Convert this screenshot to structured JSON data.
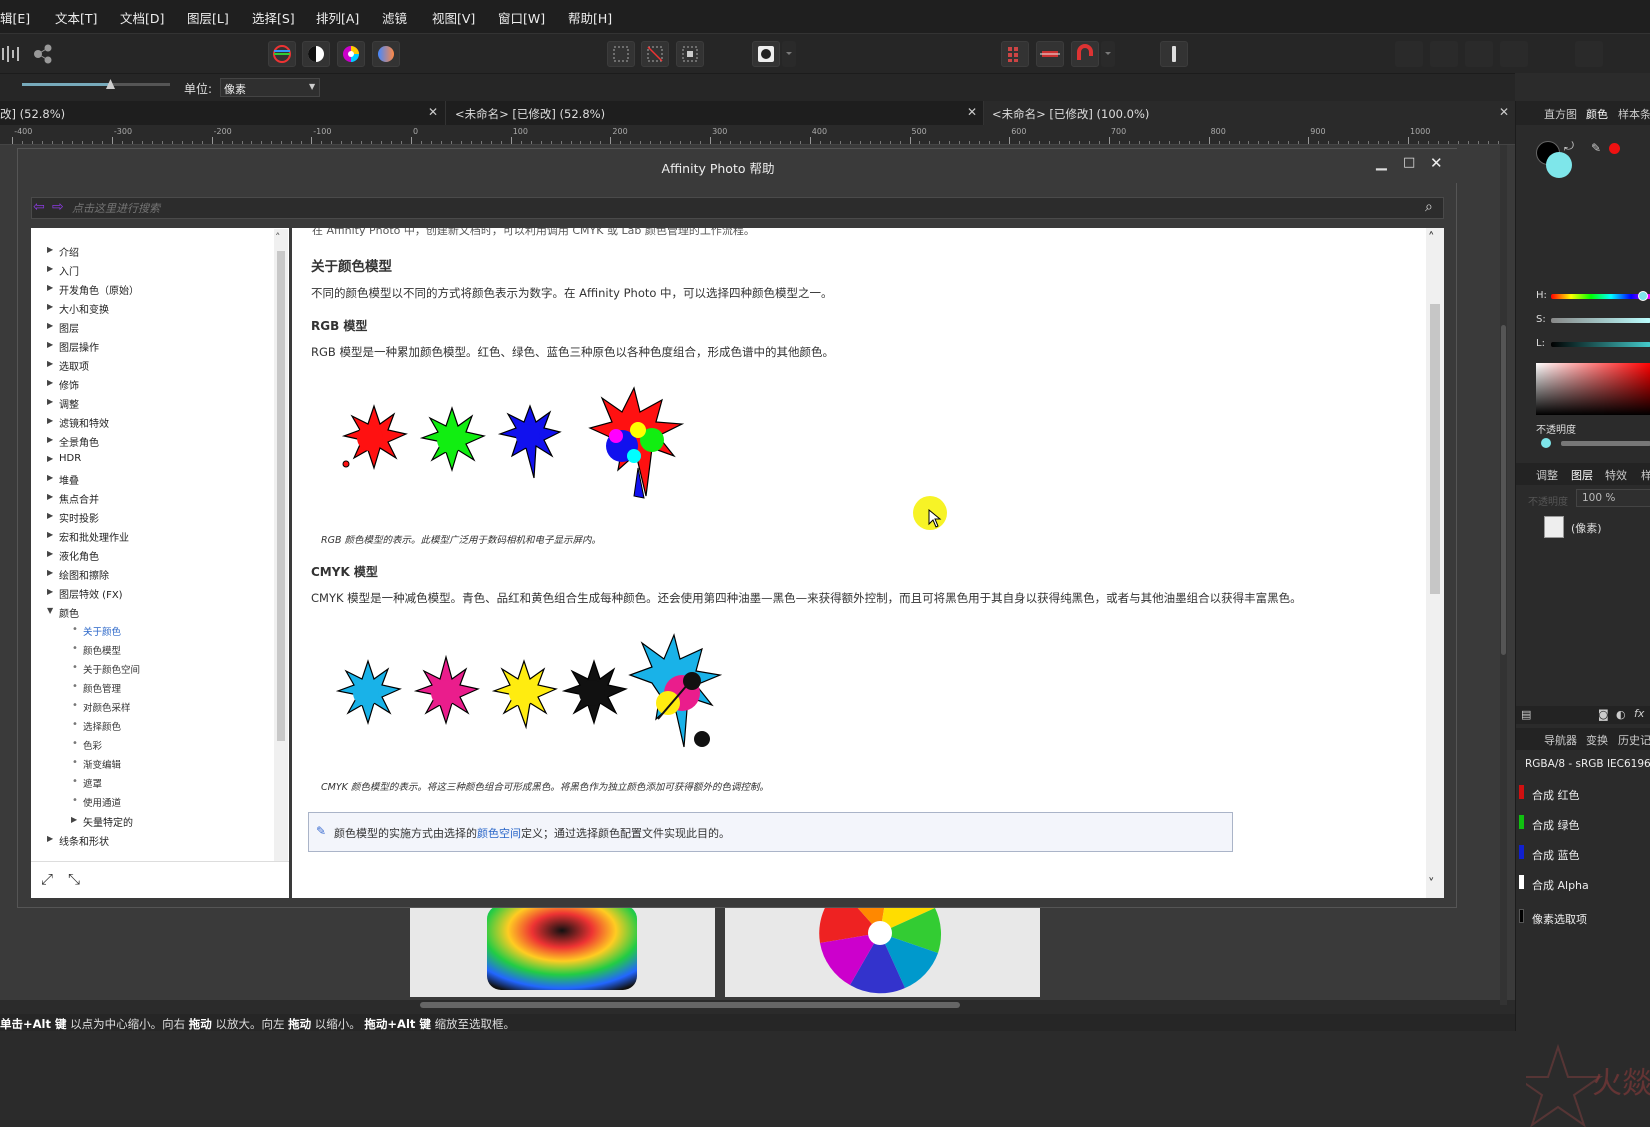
{
  "menu": [
    "辑[E]",
    "文本[T]",
    "文档[D]",
    "图层[L]",
    "选择[S]",
    "排列[A]",
    "滤镜",
    "视图[V]",
    "窗口[W]",
    "帮助[H]"
  ],
  "context": {
    "unit_label": "单位:",
    "unit_value": "像素"
  },
  "tabs": [
    {
      "label": "改] (52.8%)"
    },
    {
      "label": "<未命名> [已修改] (52.8%)"
    },
    {
      "label": "<未命名> [已修改] (100.0%)"
    }
  ],
  "ruler": [
    "-400",
    "-300",
    "-200",
    "-100",
    "0",
    "100",
    "200",
    "300",
    "400",
    "500",
    "600",
    "700",
    "800",
    "900",
    "1000"
  ],
  "help": {
    "title": "Affinity Photo 帮助",
    "search_placeholder": "点击这里进行搜索",
    "nav": [
      "介绍",
      "入门",
      "开发角色（原始）",
      "大小和变换",
      "图层",
      "图层操作",
      "选取项",
      "修饰",
      "调整",
      "滤镜和特效",
      "全景角色",
      "HDR",
      "堆叠",
      "焦点合并",
      "实时投影",
      "宏和批处理作业",
      "液化角色",
      "绘图和擦除",
      "图层特效 (FX)",
      "颜色"
    ],
    "nav_sub": [
      "关于颜色",
      "颜色模型",
      "关于颜色空间",
      "颜色管理",
      "对颜色采样",
      "选择颜色",
      "色彩",
      "渐变编辑",
      "遮罩",
      "使用通道"
    ],
    "nav_sub2": "矢量特定的",
    "nav_last": "线条和形状",
    "content": {
      "top_cut": "在 Affinity Photo 中，创建新文档时，可以利用调用 CMYK 或 Lab 颜色管理的工作流程。",
      "h1": "关于颜色模型",
      "p1": "不同的颜色模型以不同的方式将颜色表示为数字。在 Affinity Photo 中，可以选择四种颜色模型之一。",
      "h2": "RGB 模型",
      "p2": "RGB 模型是一种累加颜色模型。红色、绿色、蓝色三种原色以各种色度组合，形成色谱中的其他颜色。",
      "cap1": "RGB 颜色模型的表示。此模型广泛用于数码相机和电子显示屏内。",
      "h3": "CMYK 模型",
      "p3": "CMYK 模型是一种减色模型。青色、品红和黄色组合生成每种颜色。还会使用第四种油墨—黑色—来获得额外控制，而且可将黑色用于其自身以获得纯黑色，或者与其他油墨组合以获得丰富黑色。",
      "cap2": "CMYK 颜色模型的表示。将这三种颜色组合可形成黑色。将黑色作为独立颜色添加可获得额外的色调控制。",
      "note_a": "颜色模型的实施方式由选择的",
      "note_link": "颜色空间",
      "note_b": "定义；通过选择颜色配置文件实现此目的。"
    }
  },
  "right_panel": {
    "tabs_top": [
      "直方图",
      "颜色",
      "样本条"
    ],
    "hsl": [
      "H:",
      "S:",
      "L:"
    ],
    "opacity_label": "不透明度",
    "tabs_mid": [
      "调整",
      "图层",
      "特效",
      "样"
    ],
    "layer_opacity_label": "不透明度",
    "layer_opacity": "100 %",
    "layer_name": "(像素)",
    "tabs_bot": [
      "导航器",
      "变换",
      "历史记"
    ],
    "profile": "RGBA/8 - sRGB IEC6196",
    "channels": [
      {
        "name": "合成 红色",
        "color": "#d01010"
      },
      {
        "name": "合成 绿色",
        "color": "#10c010"
      },
      {
        "name": "合成 蓝色",
        "color": "#1020d0"
      },
      {
        "name": "合成 Alpha",
        "color": "#ffffff"
      },
      {
        "name": "像素选取项",
        "color": "#000000"
      }
    ],
    "watermark": "火燚"
  },
  "status": {
    "k1": "单击+Alt 键",
    "t1": "以点为中心缩小。向右",
    "k2": "拖动",
    "t2": "以放大。向左",
    "k3": "拖动",
    "t3": "以缩小。",
    "k4": "拖动+Alt 键",
    "t4": "缩放至选取框。"
  }
}
